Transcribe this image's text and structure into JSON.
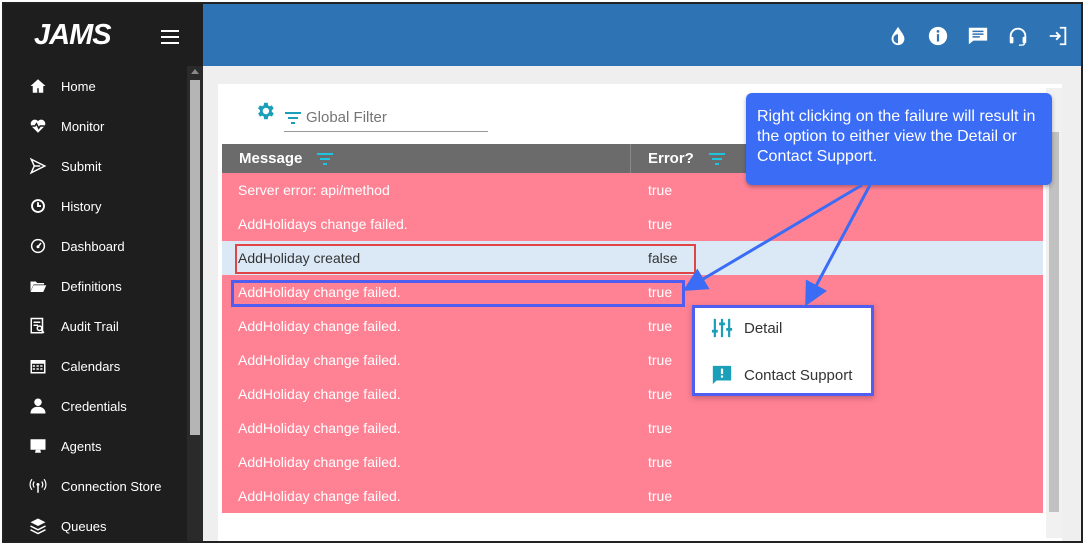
{
  "app": {
    "logo": "JAMS"
  },
  "sidebar": {
    "items": [
      {
        "label": "Home",
        "icon": "home-icon"
      },
      {
        "label": "Monitor",
        "icon": "heartbeat-icon"
      },
      {
        "label": "Submit",
        "icon": "submit-icon"
      },
      {
        "label": "History",
        "icon": "history-icon"
      },
      {
        "label": "Dashboard",
        "icon": "dashboard-icon"
      },
      {
        "label": "Definitions",
        "icon": "folder-icon"
      },
      {
        "label": "Audit Trail",
        "icon": "audit-icon"
      },
      {
        "label": "Calendars",
        "icon": "calendar-icon"
      },
      {
        "label": "Credentials",
        "icon": "user-icon"
      },
      {
        "label": "Agents",
        "icon": "monitor-icon"
      },
      {
        "label": "Connection Store",
        "icon": "antenna-icon"
      },
      {
        "label": "Queues",
        "icon": "layers-icon"
      }
    ]
  },
  "header": {
    "icons": [
      "theme-drop-icon",
      "info-icon",
      "chat-icon",
      "headset-icon",
      "logout-icon"
    ]
  },
  "filter": {
    "placeholder": "Global Filter"
  },
  "table": {
    "columns": [
      "Message",
      "Error?"
    ],
    "rows": [
      {
        "message": "Server error: api/method",
        "error": "true"
      },
      {
        "message": "AddHolidays change failed.",
        "error": "true"
      },
      {
        "message": "AddHoliday created",
        "error": "false"
      },
      {
        "message": "AddHoliday change failed.",
        "error": "true"
      },
      {
        "message": "AddHoliday change failed.",
        "error": "true"
      },
      {
        "message": "AddHoliday change failed.",
        "error": "true"
      },
      {
        "message": "AddHoliday change failed.",
        "error": "true"
      },
      {
        "message": "AddHoliday change failed.",
        "error": "true"
      },
      {
        "message": "AddHoliday change failed.",
        "error": "true"
      },
      {
        "message": "AddHoliday change failed.",
        "error": "true"
      }
    ]
  },
  "context_menu": {
    "items": [
      {
        "label": "Detail",
        "icon": "sliders-icon"
      },
      {
        "label": "Contact Support",
        "icon": "support-chat-icon"
      }
    ]
  },
  "callout": {
    "text": "Right clicking on the failure will result in the option to either view the Detail or Contact Support."
  },
  "colors": {
    "sidebar": "#1e1e1e",
    "header": "#2e74b5",
    "error_row": "#ff8294",
    "ok_row": "#dbe9f7",
    "accent": "#1a9fb8",
    "callout": "#3b6cf5"
  }
}
